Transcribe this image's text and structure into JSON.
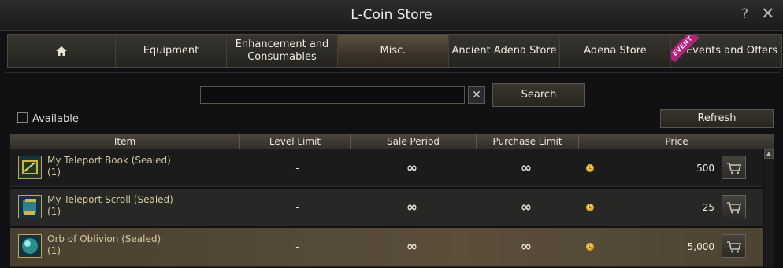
{
  "window": {
    "title": "L-Coin Store",
    "help_label": "?",
    "close_label": "✕"
  },
  "tabs": [
    {
      "label": "",
      "icon": "home-icon"
    },
    {
      "label": "Equipment"
    },
    {
      "label": "Enhancement and Consumables"
    },
    {
      "label": "Misc.",
      "active": true
    },
    {
      "label": "Ancient Adena Store"
    },
    {
      "label": "Adena Store"
    },
    {
      "label": "Events and Offers",
      "badge": "EVENT"
    }
  ],
  "search": {
    "value": "",
    "placeholder": "",
    "clear_label": "✕",
    "button_label": "Search"
  },
  "filters": {
    "available_label": "Available",
    "available_checked": false
  },
  "refresh_label": "Refresh",
  "table": {
    "headers": {
      "item": "Item",
      "level": "Level Limit",
      "sale": "Sale Period",
      "purchase": "Purchase Limit",
      "price": "Price"
    },
    "rows": [
      {
        "name": "My Teleport Book (Sealed)",
        "qty": "(1)",
        "level": "-",
        "sale": "∞",
        "purchase": "∞",
        "price": "500",
        "icon": "teleport-book-icon"
      },
      {
        "name": "My Teleport Scroll (Sealed)",
        "qty": "(1)",
        "level": "-",
        "sale": "∞",
        "purchase": "∞",
        "price": "25",
        "icon": "teleport-scroll-icon"
      },
      {
        "name": "Orb of Oblivion (Sealed)",
        "qty": "(1)",
        "level": "-",
        "sale": "∞",
        "purchase": "∞",
        "price": "5,000",
        "icon": "orb-icon"
      }
    ],
    "currency_symbol": "L"
  },
  "colors": {
    "accent": "#c9a34a",
    "event_badge": "#b0237c",
    "selected_row": "#5b4e3b"
  }
}
